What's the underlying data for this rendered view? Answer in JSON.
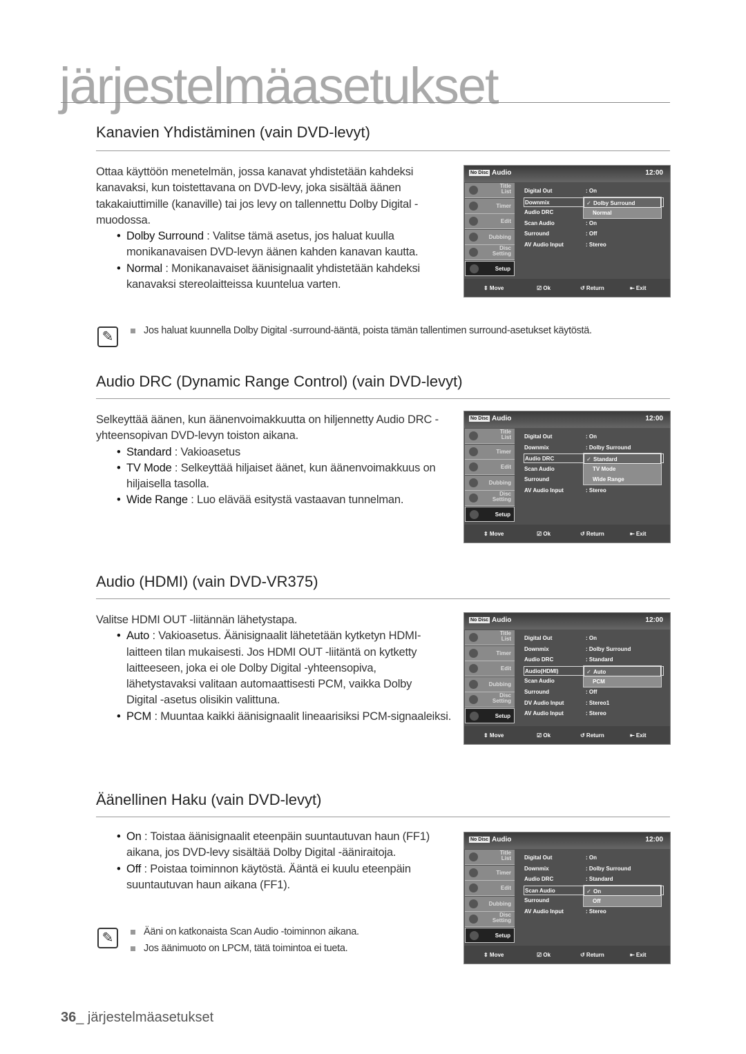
{
  "chapter_title": "järjestelmäasetukset",
  "sections": [
    {
      "title": "Kanavien Yhdistäminen (vain DVD-levyt)",
      "intro": [
        "Ottaa käyttöön menetelmän, jossa kanavat yhdistetään kahdeksi",
        "kanavaksi, kun toistettavana on DVD-levy, joka sisältää äänen",
        "takakaiuttimille (kanaville) tai jos levy on tallennettu Dolby Digital -",
        "muodossa."
      ],
      "bullets": [
        {
          "term": "Dolby Surround",
          "lines": [
            " : Valitse tämä asetus, jos haluat kuulla",
            "monikanavaisen DVD-levyn äänen kahden kanavan kautta."
          ]
        },
        {
          "term": "Normal",
          "lines": [
            " : Monikanavaiset äänisignaalit yhdistetään kahdeksi",
            "kanavaksi stereolaitteissa kuuntelua varten."
          ]
        }
      ],
      "notes": [
        "Jos haluat kuunnella Dolby Digital -surround-ääntä, poista tämän tallentimen surround-asetukset käytöstä."
      ]
    },
    {
      "title": "Audio DRC (Dynamic Range Control) (vain DVD-levyt)",
      "intro": [
        "Selkeyttää äänen, kun äänenvoimakkuutta on hiljennetty Audio DRC -",
        "yhteensopivan DVD-levyn toiston aikana."
      ],
      "bullets": [
        {
          "term": "Standard",
          "lines": [
            " : Vakioasetus"
          ]
        },
        {
          "term": "TV Mode",
          "lines": [
            " : Selkeyttää hiljaiset äänet, kun äänenvoimakkuus on",
            "hiljaisella tasolla."
          ]
        },
        {
          "term": "Wide Range",
          "lines": [
            " : Luo elävää esitystä vastaavan tunnelman."
          ]
        }
      ]
    },
    {
      "title": "Audio (HDMI) (vain DVD-VR375)",
      "intro": [
        "Valitse HDMI OUT -liitännän lähetystapa."
      ],
      "bullets": [
        {
          "term": "Auto",
          "lines": [
            " : Vakioasetus. Äänisignaalit lähetetään kytketyn HDMI-",
            "laitteen tilan mukaisesti. Jos HDMI OUT -liitäntä on kytketty",
            "laitteeseen, joka ei ole Dolby Digital -yhteensopiva,",
            "lähetystavaksi valitaan automaattisesti PCM, vaikka Dolby",
            "Digital -asetus olisikin valittuna."
          ]
        },
        {
          "term": "PCM",
          "lines": [
            " : Muuntaa kaikki äänisignaalit lineaarisiksi PCM-signaaleiksi."
          ]
        }
      ]
    },
    {
      "title": "Äänellinen Haku (vain DVD-levyt)",
      "bullets": [
        {
          "term": "On",
          "lines": [
            " : Toistaa äänisignaalit eteenpäin suuntautuvan haun (FF1)",
            "aikana, jos DVD-levy sisältää Dolby Digital -ääniraitoja."
          ]
        },
        {
          "term": "Off",
          "lines": [
            " : Poistaa toiminnon käytöstä. Ääntä ei kuulu eteenpäin",
            "suuntautuvan haun aikana (FF1)."
          ]
        }
      ],
      "notes": [
        "Ääni on katkonaista Scan Audio -toiminnon aikana.",
        "Jos äänimuoto on LPCM, tätä toimintoa ei tueta."
      ]
    }
  ],
  "screens": [
    {
      "badge": "No Disc",
      "title": "Audio",
      "time": "12:00",
      "sidebar": [
        "Title List",
        "Timer",
        "Edit",
        "Dubbing",
        "Disc Setting",
        "Setup"
      ],
      "sidebar_selected": 5,
      "rows": [
        [
          "Digital Out",
          ": On"
        ],
        [
          "Downmix",
          ""
        ],
        [
          "Audio DRC",
          ""
        ],
        [
          "Scan Audio",
          ": On"
        ],
        [
          "Surround",
          ": Off"
        ],
        [
          "AV Audio Input",
          ": Stereo"
        ]
      ],
      "highlight": 1,
      "popup": [
        "Dolby Surround",
        "Normal"
      ],
      "popup_selected": 0,
      "footer": [
        "Move",
        "Ok",
        "Return",
        "Exit"
      ]
    },
    {
      "badge": "No Disc",
      "title": "Audio",
      "time": "12:00",
      "sidebar": [
        "Title List",
        "Timer",
        "Edit",
        "Dubbing",
        "Disc Setting",
        "Setup"
      ],
      "sidebar_selected": 5,
      "rows": [
        [
          "Digital Out",
          ": On"
        ],
        [
          "Downmix",
          ": Dolby Surround"
        ],
        [
          "Audio DRC",
          ""
        ],
        [
          "Scan Audio",
          ""
        ],
        [
          "Surround",
          ""
        ],
        [
          "AV Audio Input",
          ": Stereo"
        ]
      ],
      "highlight": 2,
      "popup": [
        "Standard",
        "TV Mode",
        "Wide Range"
      ],
      "popup_selected": 0,
      "footer": [
        "Move",
        "Ok",
        "Return",
        "Exit"
      ]
    },
    {
      "badge": "No Disc",
      "title": "Audio",
      "time": "12:00",
      "sidebar": [
        "Title List",
        "Timer",
        "Edit",
        "Dubbing",
        "Disc Setting",
        "Setup"
      ],
      "sidebar_selected": 5,
      "rows": [
        [
          "Digital Out",
          ": On"
        ],
        [
          "Downmix",
          ": Dolby Surround"
        ],
        [
          "Audio DRC",
          ": Standard"
        ],
        [
          "Audio(HDMI)",
          ""
        ],
        [
          "Scan Audio",
          ""
        ],
        [
          "Surround",
          ": Off"
        ],
        [
          "DV Audio Input",
          ": Stereo1"
        ],
        [
          "AV Audio Input",
          ": Stereo"
        ]
      ],
      "highlight": 3,
      "popup": [
        "Auto",
        "PCM"
      ],
      "popup_selected": 0,
      "footer": [
        "Move",
        "Ok",
        "Return",
        "Exit"
      ]
    },
    {
      "badge": "No Disc",
      "title": "Audio",
      "time": "12:00",
      "sidebar": [
        "Title List",
        "Timer",
        "Edit",
        "Dubbing",
        "Disc Setting",
        "Setup"
      ],
      "sidebar_selected": 5,
      "rows": [
        [
          "Digital Out",
          ": On"
        ],
        [
          "Downmix",
          ": Dolby Surround"
        ],
        [
          "Audio DRC",
          ": Standard"
        ],
        [
          "Scan Audio",
          ""
        ],
        [
          "Surround",
          ""
        ],
        [
          "AV Audio Input",
          ": Stereo"
        ]
      ],
      "highlight": 3,
      "popup": [
        "On",
        "Off"
      ],
      "popup_selected": 0,
      "footer": [
        "Move",
        "Ok",
        "Return",
        "Exit"
      ]
    }
  ],
  "footer": {
    "page_number": "36",
    "label": "_ järjestelmäasetukset"
  }
}
